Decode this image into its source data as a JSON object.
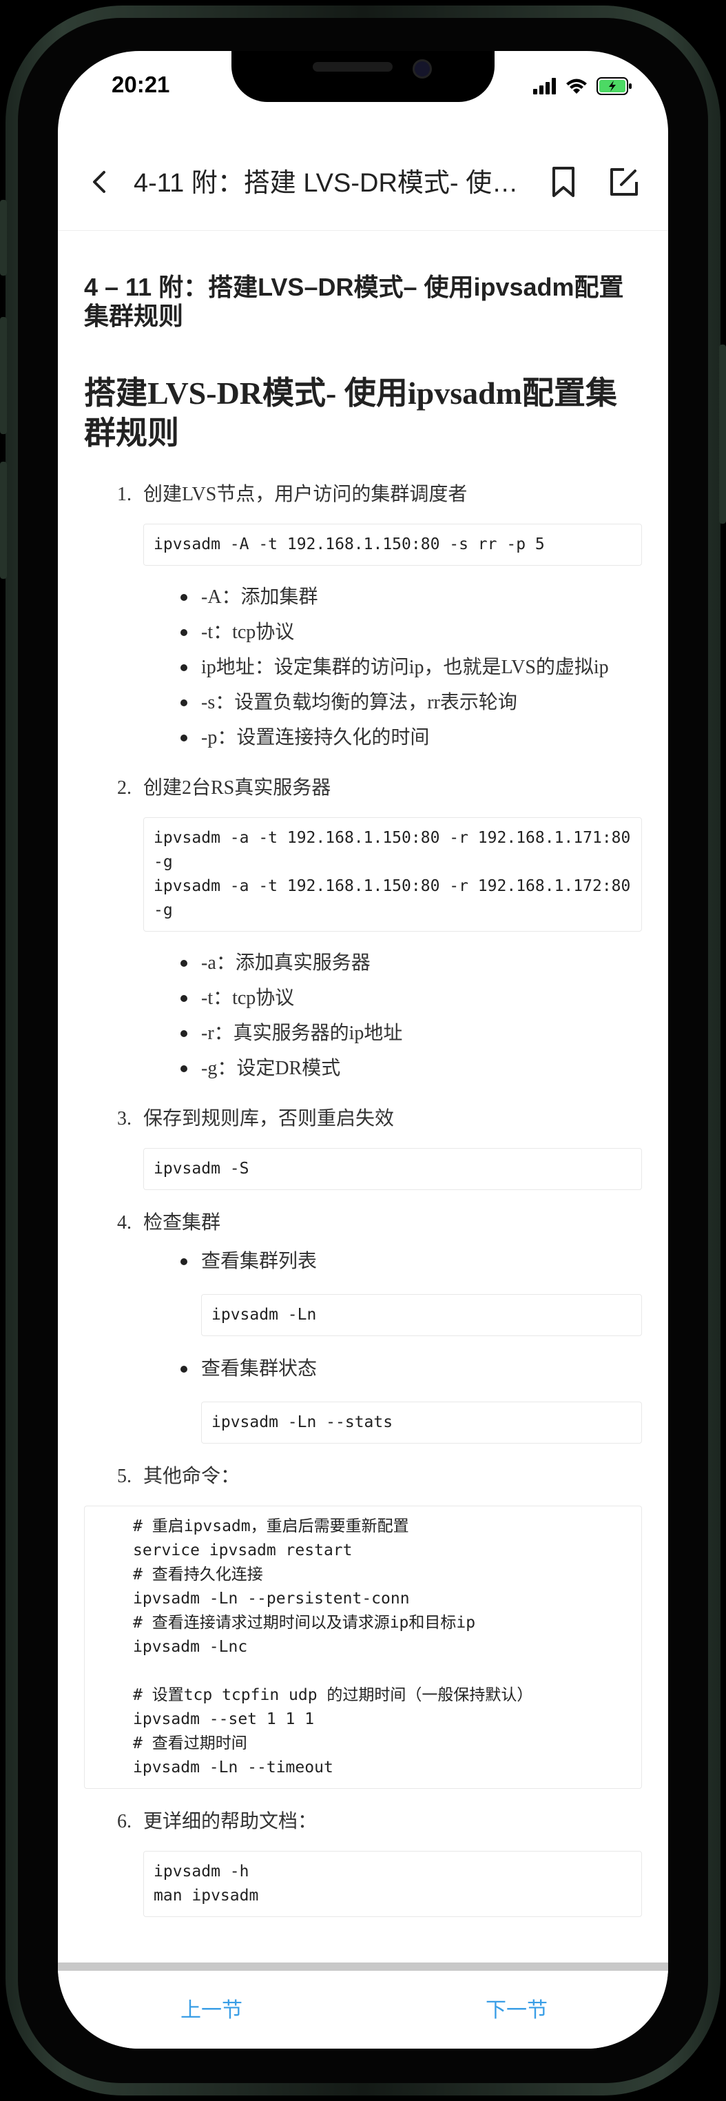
{
  "status": {
    "time": "20:21"
  },
  "nav": {
    "title": "4-11 附：搭建 LVS-DR模式- 使用ipvsadm配置集群规则"
  },
  "article": {
    "doc_title": "4 – 11 附：搭建LVS–DR模式– 使用ipvsadm配置集群规则",
    "heading": "搭建LVS-DR模式- 使用ipvsadm配置集群规则",
    "steps": [
      {
        "num": "1.",
        "text": "创建LVS节点，用户访问的集群调度者",
        "code": "ipvsadm -A -t 192.168.1.150:80 -s rr -p 5",
        "bullets": [
          "-A：添加集群",
          "-t：tcp协议",
          "ip地址：设定集群的访问ip，也就是LVS的虚拟ip",
          "-s：设置负载均衡的算法，rr表示轮询",
          "-p：设置连接持久化的时间"
        ]
      },
      {
        "num": "2.",
        "text": "创建2台RS真实服务器",
        "code": "ipvsadm -a -t 192.168.1.150:80 -r 192.168.1.171:80 -g\nipvsadm -a -t 192.168.1.150:80 -r 192.168.1.172:80 -g",
        "bullets": [
          "-a：添加真实服务器",
          "-t：tcp协议",
          "-r：真实服务器的ip地址",
          "-g：设定DR模式"
        ]
      },
      {
        "num": "3.",
        "text": "保存到规则库，否则重启失效",
        "code": "ipvsadm -S"
      },
      {
        "num": "4.",
        "text": "检查集群",
        "sub": [
          {
            "text": "查看集群列表",
            "code": "ipvsadm -Ln"
          },
          {
            "text": "查看集群状态",
            "code": "ipvsadm -Ln --stats"
          }
        ]
      },
      {
        "num": "5.",
        "text": "其他命令：",
        "code": "# 重启ipvsadm，重启后需要重新配置\nservice ipvsadm restart\n# 查看持久化连接\nipvsadm -Ln --persistent-conn\n# 查看连接请求过期时间以及请求源ip和目标ip\nipvsadm -Lnc\n\n# 设置tcp tcpfin udp 的过期时间（一般保持默认）\nipvsadm --set 1 1 1\n# 查看过期时间\nipvsadm -Ln --timeout"
      },
      {
        "num": "6.",
        "text": "更详细的帮助文档：",
        "code": "ipvsadm -h\nman ipvsadm"
      }
    ]
  },
  "bottom_nav": {
    "prev": "上一节",
    "next": "下一节"
  },
  "colors": {
    "accent": "#3a9ee6",
    "battery": "#4cd964"
  }
}
